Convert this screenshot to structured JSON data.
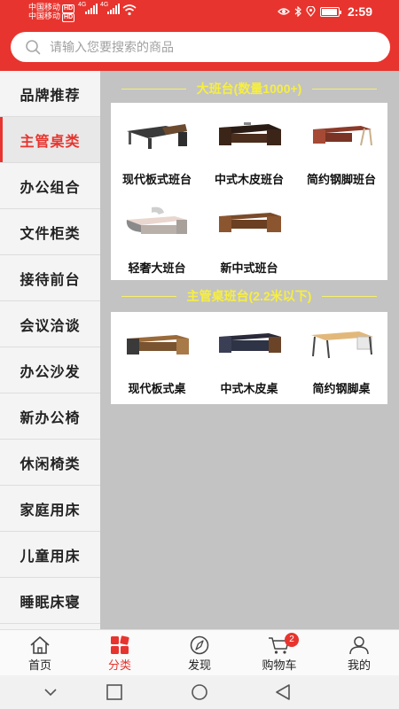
{
  "status_bar": {
    "carrier_1": "中国移动",
    "carrier_2": "中国移动",
    "hd_label": "HD",
    "net_1": "4G",
    "net_2": "4G",
    "time": "2:59"
  },
  "search": {
    "placeholder": "请输入您要搜索的商品",
    "icon": "search-icon"
  },
  "sidebar": {
    "items": [
      {
        "label": "品牌推荐",
        "active": false
      },
      {
        "label": "主管桌类",
        "active": true
      },
      {
        "label": "办公组合",
        "active": false
      },
      {
        "label": "文件柜类",
        "active": false
      },
      {
        "label": "接待前台",
        "active": false
      },
      {
        "label": "会议洽谈",
        "active": false
      },
      {
        "label": "办公沙发",
        "active": false
      },
      {
        "label": "新办公椅",
        "active": false
      },
      {
        "label": "休闲椅类",
        "active": false
      },
      {
        "label": "家庭用床",
        "active": false
      },
      {
        "label": "儿童用床",
        "active": false
      },
      {
        "label": "睡眠床寝",
        "active": false
      }
    ]
  },
  "sections": [
    {
      "title": "大班台(数量1000+)",
      "products": [
        {
          "label": "现代板式班台"
        },
        {
          "label": "中式木皮班台"
        },
        {
          "label": "简约钢脚班台"
        },
        {
          "label": "轻奢大班台"
        },
        {
          "label": "新中式班台"
        }
      ]
    },
    {
      "title": "主管桌班台(2.2米以下)",
      "products": [
        {
          "label": "现代板式桌"
        },
        {
          "label": "中式木皮桌"
        },
        {
          "label": "简约钢脚桌"
        }
      ]
    }
  ],
  "tabbar": {
    "tabs": [
      {
        "label": "首页",
        "icon": "home-icon"
      },
      {
        "label": "分类",
        "icon": "category-icon"
      },
      {
        "label": "发现",
        "icon": "compass-icon"
      },
      {
        "label": "购物车",
        "icon": "cart-icon",
        "badge": "2"
      },
      {
        "label": "我的",
        "icon": "user-icon"
      }
    ],
    "active_tab": "分类"
  },
  "colors": {
    "brand": "#e8342e",
    "section_title": "#f7ef3e",
    "content_bg": "#c3c3c3"
  }
}
